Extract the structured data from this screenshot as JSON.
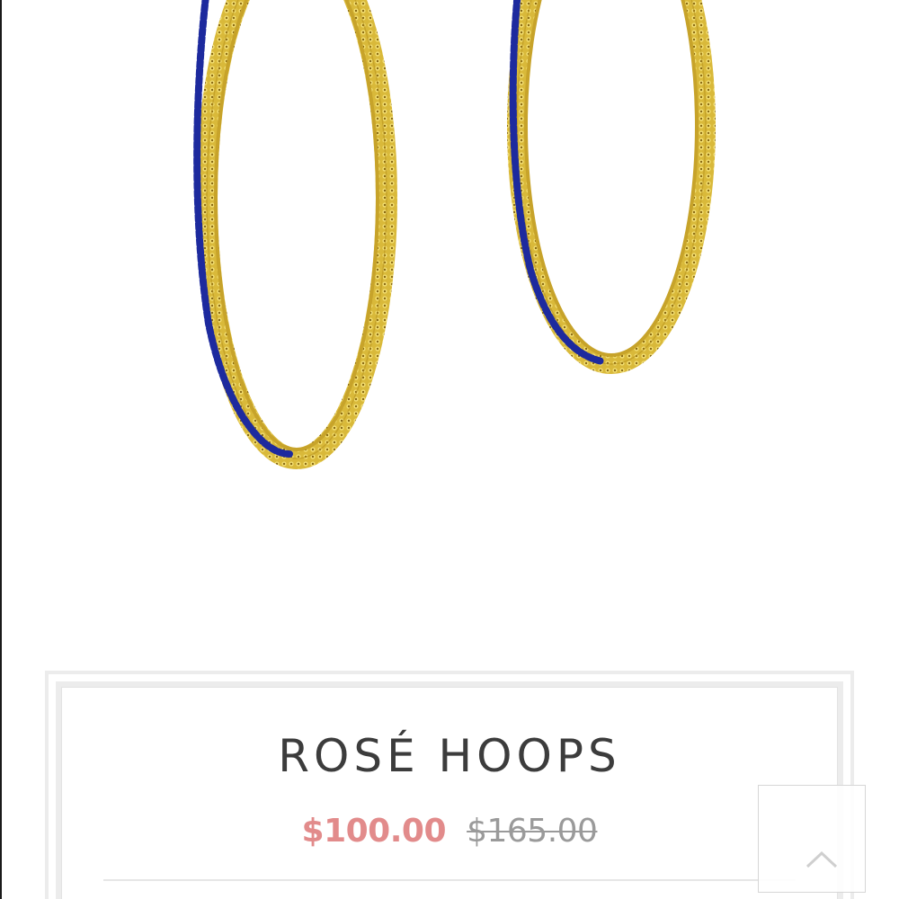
{
  "product": {
    "title": "ROSÉ HOOPS",
    "sale_price": "$100.00",
    "original_price": "$165.00"
  },
  "image": {
    "subject": "earring",
    "colors": {
      "gold": "#d8b638",
      "gold_dark": "#a8861a",
      "stone": "#1d2a9e"
    }
  },
  "colors": {
    "sale_price": "#e28b8b",
    "original_price": "#9a9a9a",
    "title": "#3c3c3c",
    "card_border": "#ececec"
  },
  "icons": {
    "back_to_top": "chevron-up-icon"
  }
}
